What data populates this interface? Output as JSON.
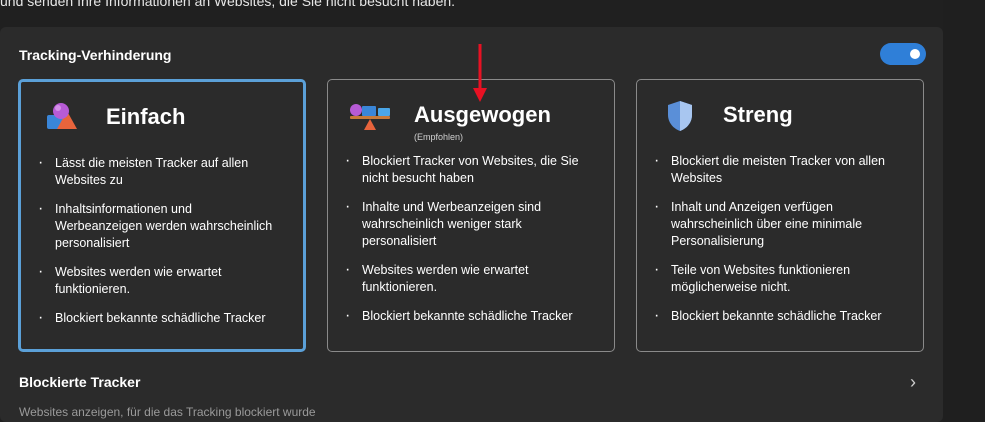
{
  "intro_text": "und senden Ihre Informationen an Websites, die Sie nicht besucht haben.",
  "section_title": "Tracking-Verhinderung",
  "toggle": {
    "state": "on",
    "color": "#2f7fd8"
  },
  "cards": [
    {
      "title": "Einfach",
      "subtitle": "",
      "icon": "shapes-icon",
      "selected": true,
      "bullets": [
        "Lässt die meisten Tracker auf allen Websites zu",
        "Inhaltsinformationen und Werbeanzeigen werden wahrscheinlich personalisiert",
        "Websites werden wie erwartet funktionieren.",
        "Blockiert bekannte schädliche Tracker"
      ]
    },
    {
      "title": "Ausgewogen",
      "subtitle": "(Empfohlen)",
      "icon": "balance-scale-icon",
      "selected": false,
      "bullets": [
        "Blockiert Tracker von Websites, die Sie nicht besucht haben",
        "Inhalte und Werbeanzeigen sind wahrscheinlich weniger stark personalisiert",
        "Websites werden wie erwartet funktionieren.",
        "Blockiert bekannte schädliche Tracker"
      ]
    },
    {
      "title": "Streng",
      "subtitle": "",
      "icon": "shield-icon",
      "selected": false,
      "bullets": [
        "Blockiert die meisten Tracker von allen Websites",
        "Inhalt und Anzeigen verfügen wahrscheinlich über eine minimale Personalisierung",
        "Teile von Websites funktionieren möglicherweise nicht.",
        "Blockiert bekannte schädliche Tracker"
      ]
    }
  ],
  "blocked_trackers": {
    "title": "Blockierte Tracker",
    "description": "Websites anzeigen, für die das Tracking blockiert wurde",
    "chevron": "chevron-right-icon"
  },
  "annotation": {
    "type": "red-arrow-down",
    "color": "#e81123"
  }
}
